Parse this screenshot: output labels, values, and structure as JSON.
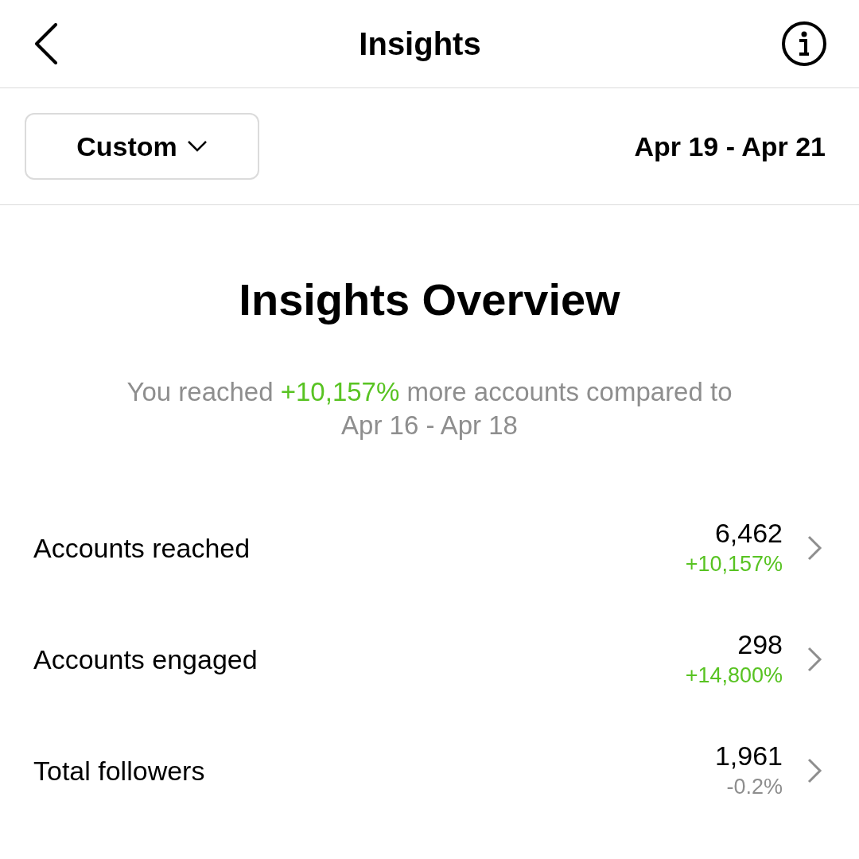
{
  "header": {
    "title": "Insights"
  },
  "filter": {
    "period": "Custom",
    "date_range": "Apr 19 - Apr 21"
  },
  "overview": {
    "title": "Insights Overview",
    "summary": {
      "before": "You reached ",
      "highlight": "+10,157%",
      "after": " more accounts compared to Apr 16 - Apr 18"
    }
  },
  "metrics": [
    {
      "label": "Accounts reached",
      "value": "6,462",
      "change": "+10,157%",
      "positive": true
    },
    {
      "label": "Accounts engaged",
      "value": "298",
      "change": "+14,800%",
      "positive": true
    },
    {
      "label": "Total followers",
      "value": "1,961",
      "change": "-0.2%",
      "positive": false
    }
  ]
}
